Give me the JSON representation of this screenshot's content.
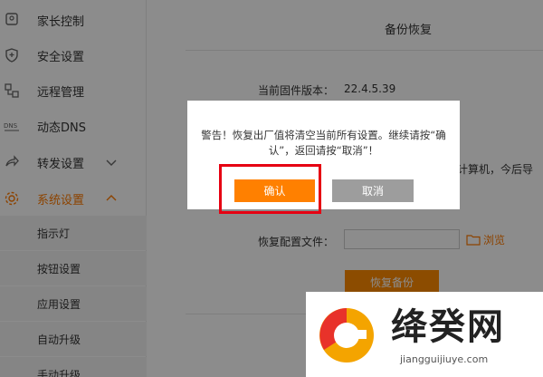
{
  "sidebar": {
    "items": [
      {
        "label": "家长控制",
        "icon": "parental-control-icon"
      },
      {
        "label": "安全设置",
        "icon": "shield-icon"
      },
      {
        "label": "远程管理",
        "icon": "remote-management-icon"
      },
      {
        "label": "动态DNS",
        "icon": "dns-icon"
      },
      {
        "label": "转发设置",
        "icon": "forward-icon"
      },
      {
        "label": "系统设置",
        "icon": "gear-icon"
      }
    ],
    "sub_items": [
      "指示灯",
      "按钮设置",
      "应用设置",
      "自动升级",
      "手动升级"
    ],
    "accent": "#ff7a00"
  },
  "main": {
    "title": "备份恢复",
    "firmware_label": "当前固件版本：",
    "firmware_value": "22.4.5.39",
    "hint_text": "计算机，今后导",
    "restore_file_label": "恢复配置文件：",
    "browse_label": "浏览",
    "restore_button": "恢复备份"
  },
  "dialog": {
    "message": "警告！恢复出厂值将清空当前所有设置。继续请按“确认”，返回请按“取消”！",
    "confirm_label": "确认",
    "cancel_label": "取消"
  },
  "watermark": {
    "title": "绛癸网",
    "subtitle": "jiangguijiuye.com"
  }
}
